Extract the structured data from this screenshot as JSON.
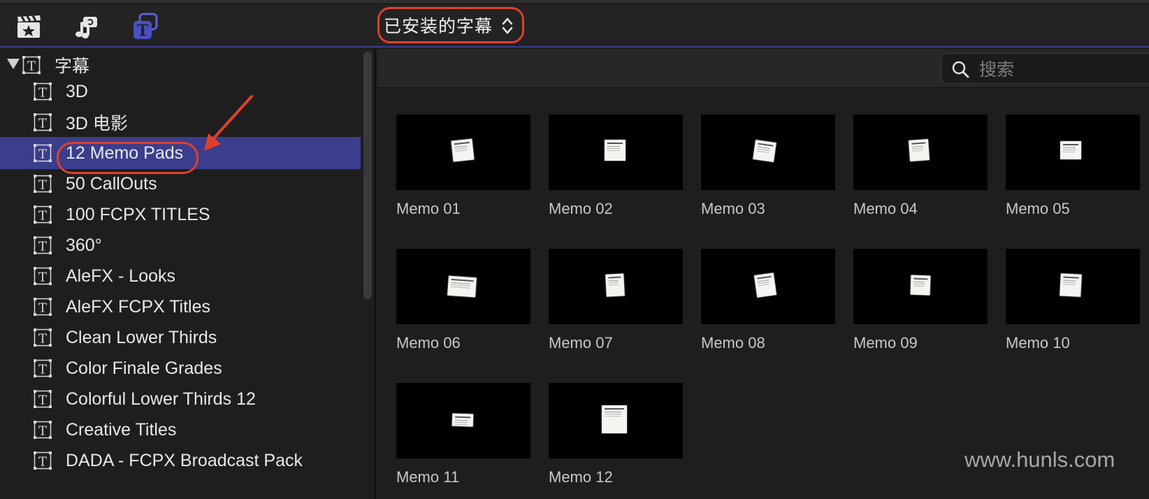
{
  "toolbar": {
    "icons": [
      "clapper-star-icon",
      "music-camera-icon",
      "titles-icon"
    ],
    "dropdown_label": "已安装的字幕"
  },
  "sidebar": {
    "root_label": "字幕",
    "items": [
      {
        "label": "3D"
      },
      {
        "label": "3D 电影"
      },
      {
        "label": "12 Memo Pads",
        "selected": true
      },
      {
        "label": "50 CallOuts"
      },
      {
        "label": "100 FCPX TITLES"
      },
      {
        "label": "360°"
      },
      {
        "label": "AleFX - Looks"
      },
      {
        "label": "AleFX FCPX Titles"
      },
      {
        "label": "Clean Lower Thirds"
      },
      {
        "label": "Color Finale Grades"
      },
      {
        "label": "Colorful Lower Thirds 12"
      },
      {
        "label": "Creative Titles"
      },
      {
        "label": "DADA - FCPX Broadcast Pack"
      }
    ]
  },
  "search": {
    "placeholder": "搜索",
    "value": ""
  },
  "browser": {
    "items": [
      {
        "label": "Memo 01"
      },
      {
        "label": "Memo 02"
      },
      {
        "label": "Memo 03"
      },
      {
        "label": "Memo 04"
      },
      {
        "label": "Memo 05"
      },
      {
        "label": "Memo 06"
      },
      {
        "label": "Memo 07"
      },
      {
        "label": "Memo 08"
      },
      {
        "label": "Memo 09"
      },
      {
        "label": "Memo 10"
      },
      {
        "label": "Memo 11"
      },
      {
        "label": "Memo 12"
      }
    ]
  },
  "watermark": "www.hunls.com",
  "colors": {
    "highlight": "#e0402b",
    "selection": "#3b3e8c",
    "accent": "#4a4fc4"
  }
}
